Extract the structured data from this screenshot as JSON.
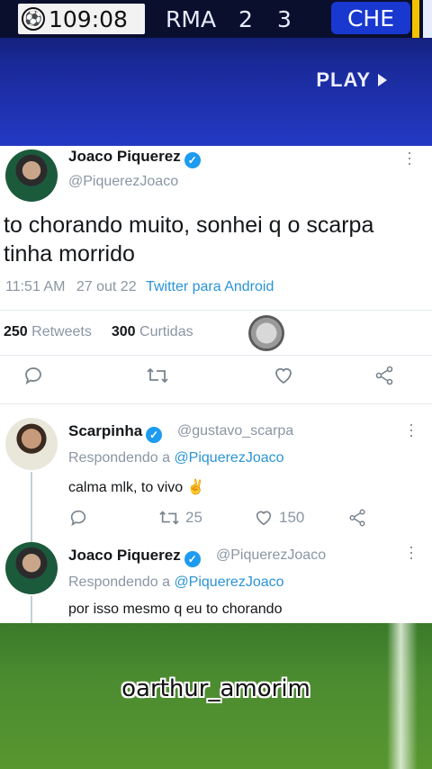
{
  "scoreboard": {
    "clock": "109:08",
    "home_team": "RMA",
    "home_score": "2",
    "away_score": "3",
    "away_team": "CHE"
  },
  "video": {
    "play_label": "PLAY"
  },
  "tweet": {
    "author_name": "Joaco Piquerez",
    "author_handle": "@PiquerezJoaco",
    "text": "to chorando muito, sonhei q o scarpa tinha morrido",
    "time": "11:51 AM",
    "date": "27 out 22",
    "source": "Twitter para Android",
    "retweets_count": "250",
    "retweets_label": "Retweets",
    "likes_count": "300",
    "likes_label": "Curtidas"
  },
  "replies": [
    {
      "author_name": "Scarpinha",
      "author_handle": "@gustavo_scarpa",
      "replying_prefix": "Respondendo a",
      "replying_to": "@PiquerezJoaco",
      "text": "calma mlk, to vivo ✌",
      "retweets": "25",
      "likes": "150"
    },
    {
      "author_name": "Joaco Piquerez",
      "author_handle": "@PiquerezJoaco",
      "replying_prefix": "Respondendo a",
      "replying_to": "@PiquerezJoaco",
      "text": "por isso mesmo q eu to chorando"
    }
  ],
  "watermark": "oarthur_amorim",
  "colors": {
    "accent": "#1d9bf0",
    "link": "#2a94d6",
    "banner": "#2339c4",
    "pitch": "#4c8c30"
  }
}
